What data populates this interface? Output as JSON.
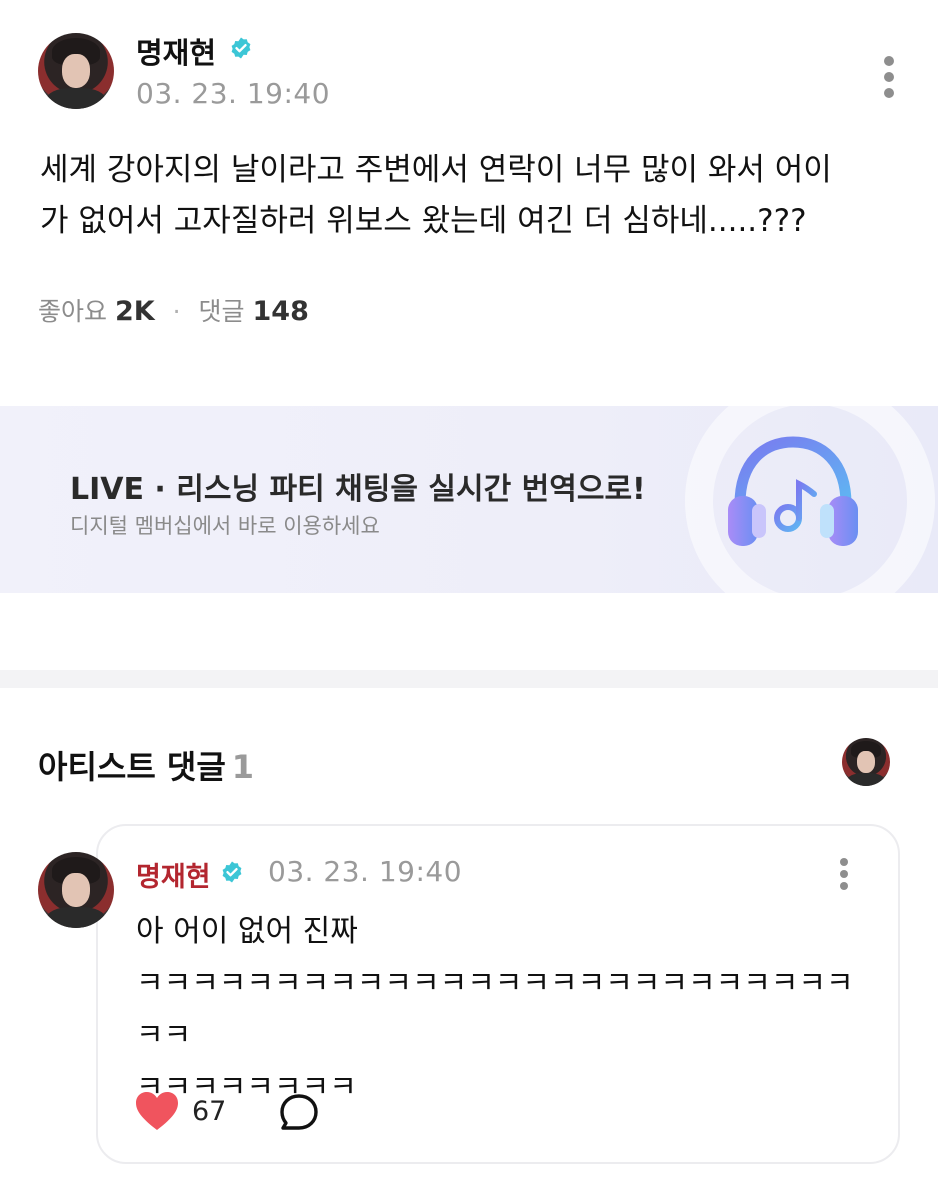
{
  "post": {
    "author": "명재현",
    "date": "03. 23. 19:40",
    "body_line1": "세계 강아지의 날이라고 주변에서 연락이 너무 많이 와서 어이",
    "body_line2": "가 없어서 고자질하러 위보스 왔는데 여긴 더 심하네.....???",
    "likes_label": "좋아요",
    "likes_value": "2K",
    "comments_label": "댓글",
    "comments_value": "148",
    "separator": "·"
  },
  "banner": {
    "title": "LIVE · 리스닝 파티 채팅을 실시간 번역으로!",
    "subtitle": "디지털 멤버십에서 바로 이용하세요",
    "icon": "headphone-music-icon"
  },
  "artist_comments": {
    "title": "아티스트 댓글",
    "count": "1"
  },
  "comment": {
    "author": "명재현",
    "date": "03. 23. 19:40",
    "line1": "아 어이 없어 진짜",
    "line2": "ㅋㅋㅋㅋㅋㅋㅋㅋㅋㅋㅋㅋㅋㅋㅋㅋㅋㅋㅋㅋㅋㅋㅋㅋㅋㅋㅋㅋ",
    "line3": "ㅋㅋㅋㅋㅋㅋㅋㅋ",
    "likes": "67"
  },
  "colors": {
    "verified": "#3cc6d6",
    "author_red": "#b3262f",
    "heart": "#f0545e",
    "muted": "#9a9a9a"
  },
  "icons": [
    "verified-icon",
    "more-icon",
    "headphone-music-icon",
    "heart-icon",
    "reply-bubble-icon"
  ]
}
